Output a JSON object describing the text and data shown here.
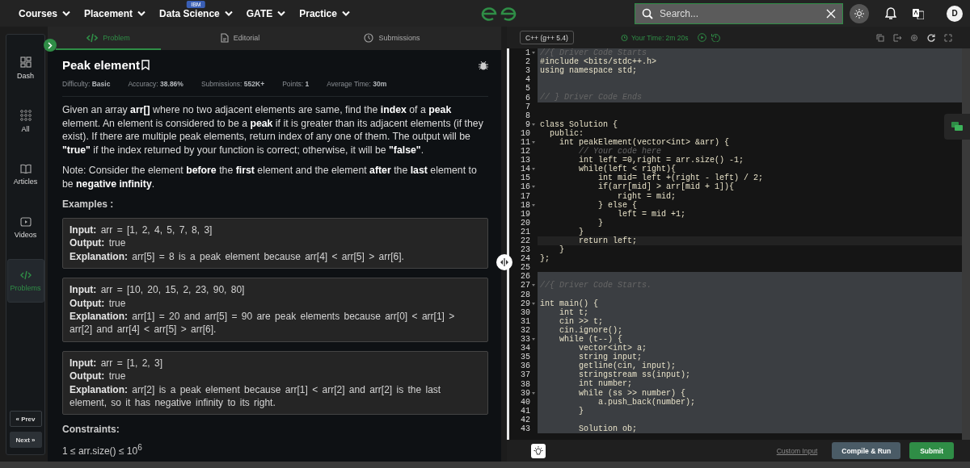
{
  "nav": {
    "menus": [
      {
        "label": "Courses"
      },
      {
        "label": "Placement"
      },
      {
        "label": "Data Science",
        "badge": "IBM"
      },
      {
        "label": "GATE"
      },
      {
        "label": "Practice"
      }
    ],
    "search": {
      "placeholder": "Search..."
    },
    "avatar": "D"
  },
  "sidebar": {
    "items": [
      {
        "label": "Dash",
        "selected": false
      },
      {
        "label": "All",
        "selected": false
      },
      {
        "label": "Articles",
        "selected": false
      },
      {
        "label": "Videos",
        "selected": false
      },
      {
        "label": "Problems",
        "selected": true
      }
    ],
    "prev": "« Prev",
    "next": "Next »"
  },
  "tabs": [
    {
      "label": "Problem",
      "selected": true
    },
    {
      "label": "Editorial",
      "selected": false
    },
    {
      "label": "Submissions",
      "selected": false
    }
  ],
  "problem": {
    "title": "Peak element",
    "meta": [
      "Difficulty: **Basic**",
      "Accuracy: **38.86%**",
      "Submissions: **552K+**",
      "Points: **1**",
      "Average Time: **30m**"
    ],
    "paragraphs": [
      "Given an array **arr[]** where no two adjacent elements are same, find the **index** of a **peak** element. An element is considered to be a **peak** if it is greater than its adjacent elements (if they exist). If there are multiple peak elements, return index of any one of them. The output will be **\"true\"** if the index returned by your function is correct; otherwise, it will be **\"false\"**.",
      "Note: Consider the element **before** the **first** element and the element **after** the **last** element to be **negative infinity**."
    ],
    "examples_heading": "Examples :",
    "examples": [
      [
        "**Input:** arr = [1, 2, 4, 5, 7, 8, 3]",
        "**Output:** true",
        "**Explanation:** arr[5] = 8 is a peak element because arr[4] < arr[5] > arr[6]."
      ],
      [
        "**Input:** arr = [10, 20, 15, 2, 23, 90, 80]",
        "**Output:** true",
        "**Explanation:** arr[1] = 20 and arr[5] = 90 are peak elements because arr[0] < arr[1] > arr[2] and arr[4] < arr[5] > arr[6]."
      ],
      [
        "**Input:** arr = [1, 2, 3]",
        "**Output:** true",
        "**Explanation:** arr[2] is a peak element because arr[1] < arr[2] and arr[2] is the last element, so it has negative infinity to its right."
      ]
    ],
    "constraints_heading": "Constraints:",
    "constraints": [
      "1 ≤ arr.size() ≤ 10$^{6}$"
    ]
  },
  "editor": {
    "language": "C++ (g++ 5.4)",
    "timer": "Your Time: 2m 20s",
    "lines": [
      {
        "n": "1",
        "text": "//{ Driver Code Starts",
        "kind": "comment",
        "readonly": true,
        "fold": true,
        "active": false
      },
      {
        "n": "2",
        "text": "#include <bits/stdc++.h>",
        "kind": "code",
        "readonly": true,
        "fold": false,
        "active": false
      },
      {
        "n": "3",
        "text": "using namespace std;",
        "kind": "code",
        "readonly": true,
        "fold": false,
        "active": false
      },
      {
        "n": "4",
        "kind": "code",
        "readonly": true,
        "fold": false,
        "active": false
      },
      {
        "n": "5",
        "kind": "code",
        "readonly": true,
        "fold": false,
        "active": false
      },
      {
        "n": "6",
        "text": "// } Driver Code Ends",
        "kind": "comment",
        "readonly": true,
        "fold": false,
        "active": false
      },
      {
        "n": "7",
        "kind": "code",
        "readonly": false,
        "fold": false,
        "active": false
      },
      {
        "n": "8",
        "kind": "code",
        "readonly": false,
        "fold": false,
        "active": false
      },
      {
        "n": "9",
        "text": "class Solution {",
        "kind": "code",
        "readonly": false,
        "fold": true,
        "active": false
      },
      {
        "n": "10",
        "text": "  public:",
        "kind": "code",
        "readonly": false,
        "fold": false,
        "active": false
      },
      {
        "n": "11",
        "text": "    int peakElement(vector<int> &arr) {",
        "kind": "code",
        "readonly": false,
        "fold": true,
        "active": false
      },
      {
        "n": "12",
        "text": "        // Your code here",
        "kind": "comment",
        "readonly": false,
        "fold": false,
        "active": false
      },
      {
        "n": "13",
        "text": "        int left =0,right = arr.size() -1;",
        "kind": "code",
        "readonly": false,
        "fold": false,
        "active": false
      },
      {
        "n": "14",
        "text": "        while(left < right){",
        "kind": "code",
        "readonly": false,
        "fold": true,
        "active": false
      },
      {
        "n": "15",
        "text": "            int mid= left +(right - left) / 2;",
        "kind": "code",
        "readonly": false,
        "fold": false,
        "active": false
      },
      {
        "n": "16",
        "text": "            if(arr[mid] > arr[mid + 1]){",
        "kind": "code",
        "readonly": false,
        "fold": true,
        "active": false
      },
      {
        "n": "17",
        "text": "                right = mid;",
        "kind": "code",
        "readonly": false,
        "fold": false,
        "active": false
      },
      {
        "n": "18",
        "text": "            } else {",
        "kind": "code",
        "readonly": false,
        "fold": true,
        "active": false
      },
      {
        "n": "19",
        "text": "                left = mid +1;",
        "kind": "code",
        "readonly": false,
        "fold": false,
        "active": false
      },
      {
        "n": "20",
        "text": "            }",
        "kind": "code",
        "readonly": false,
        "fold": false,
        "active": false
      },
      {
        "n": "21",
        "text": "        }",
        "kind": "code",
        "readonly": false,
        "fold": false,
        "active": false
      },
      {
        "n": "22",
        "text": "        return left;",
        "kind": "code",
        "readonly": false,
        "fold": false,
        "active": true
      },
      {
        "n": "23",
        "text": "    }",
        "kind": "code",
        "readonly": false,
        "fold": false,
        "active": false
      },
      {
        "n": "24",
        "text": "};",
        "kind": "code",
        "readonly": false,
        "fold": false,
        "active": false
      },
      {
        "n": "25",
        "kind": "code",
        "readonly": false,
        "fold": false,
        "active": false
      },
      {
        "n": "26",
        "kind": "code",
        "readonly": true,
        "fold": false,
        "active": false
      },
      {
        "n": "27",
        "text": "//{ Driver Code Starts.",
        "kind": "comment",
        "readonly": true,
        "fold": true,
        "active": false
      },
      {
        "n": "28",
        "kind": "code",
        "readonly": true,
        "fold": false,
        "active": false
      },
      {
        "n": "29",
        "text": "int main() {",
        "kind": "code",
        "readonly": true,
        "fold": true,
        "active": false
      },
      {
        "n": "30",
        "text": "    int t;",
        "kind": "code",
        "readonly": true,
        "fold": false,
        "active": false
      },
      {
        "n": "31",
        "text": "    cin >> t;",
        "kind": "code",
        "readonly": true,
        "fold": false,
        "active": false
      },
      {
        "n": "32",
        "text": "    cin.ignore();",
        "kind": "code",
        "readonly": true,
        "fold": false,
        "active": false
      },
      {
        "n": "33",
        "text": "    while (t--) {",
        "kind": "code",
        "readonly": true,
        "fold": true,
        "active": false
      },
      {
        "n": "34",
        "text": "        vector<int> a;",
        "kind": "code",
        "readonly": true,
        "fold": false,
        "active": false
      },
      {
        "n": "35",
        "text": "        string input;",
        "kind": "code",
        "readonly": true,
        "fold": false,
        "active": false
      },
      {
        "n": "36",
        "text": "        getline(cin, input);",
        "kind": "code",
        "readonly": true,
        "fold": false,
        "active": false
      },
      {
        "n": "37",
        "text": "        stringstream ss(input);",
        "kind": "code",
        "readonly": true,
        "fold": false,
        "active": false
      },
      {
        "n": "38",
        "text": "        int number;",
        "kind": "code",
        "readonly": true,
        "fold": false,
        "active": false
      },
      {
        "n": "39",
        "text": "        while (ss >> number) {",
        "kind": "code",
        "readonly": true,
        "fold": true,
        "active": false
      },
      {
        "n": "40",
        "text": "            a.push_back(number);",
        "kind": "code",
        "readonly": true,
        "fold": false,
        "active": false
      },
      {
        "n": "41",
        "text": "        }",
        "kind": "code",
        "readonly": true,
        "fold": false,
        "active": false
      },
      {
        "n": "42",
        "kind": "code",
        "readonly": true,
        "fold": false,
        "active": false
      },
      {
        "n": "43",
        "text": "        Solution ob;",
        "kind": "code",
        "readonly": true,
        "fold": false,
        "active": false
      }
    ],
    "buttons": {
      "custom_input": "Custom Input",
      "compile": "Compile & Run",
      "submit": "Submit"
    }
  }
}
